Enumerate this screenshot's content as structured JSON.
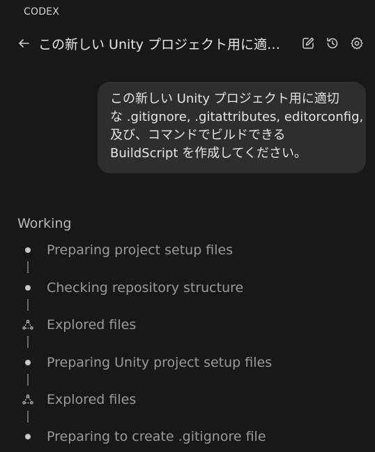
{
  "panel": {
    "label": "CODEX"
  },
  "header": {
    "title": "この新しい Unity プロジェクト用に適…",
    "icons": [
      "back-arrow-icon",
      "edit-icon",
      "history-icon",
      "gear-icon"
    ]
  },
  "message": {
    "lines": [
      "この新しい Unity プロジェクト用に適切",
      "な .gitignore, .gitattributes, editorconfig,",
      "及び、コマンドでビルドできる",
      "BuildScript を作成してください。"
    ]
  },
  "working": {
    "label": "Working",
    "steps": [
      {
        "type": "dot",
        "text": "Preparing project setup files"
      },
      {
        "type": "dot",
        "text": "Checking repository structure"
      },
      {
        "type": "explore",
        "text": "Explored files"
      },
      {
        "type": "dot",
        "text": "Preparing Unity project setup files"
      },
      {
        "type": "explore",
        "text": "Explored files"
      },
      {
        "type": "dot",
        "text": "Preparing to create .gitignore file"
      }
    ]
  },
  "colors": {
    "background": "#181818",
    "bubble": "#2e2e2e",
    "step_text": "#9a9a9a"
  }
}
